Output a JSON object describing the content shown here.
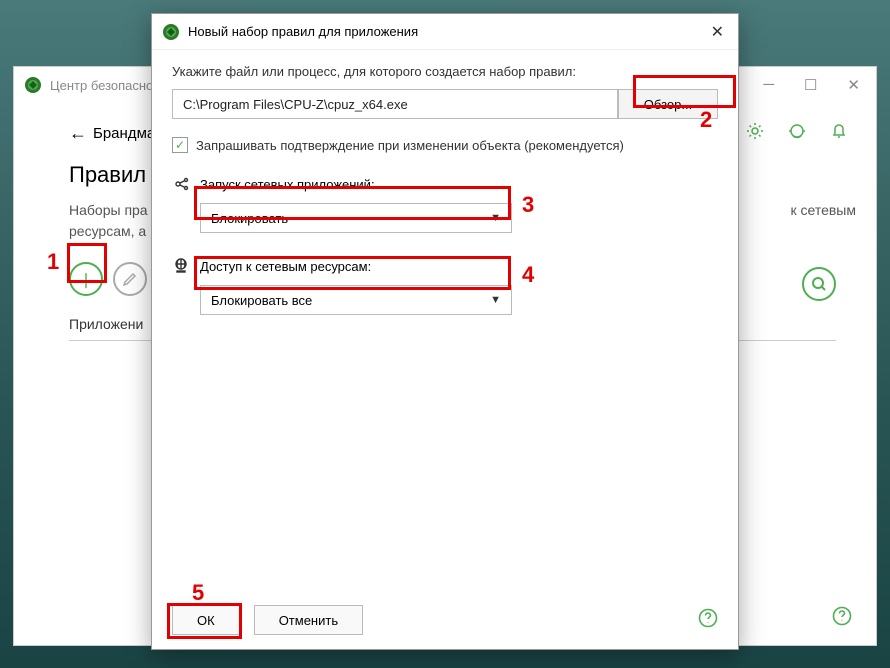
{
  "bg": {
    "title": "Центр безопасност",
    "breadcrumb": "Брандмау",
    "heading": "Правил",
    "description1": "Наборы пра",
    "description2": "ресурсам, а",
    "tab": "Приложени",
    "network_text": "к сетевым"
  },
  "fg": {
    "title": "Новый набор правил для приложения",
    "label": "Укажите файл или процесс, для которого создается набор правил:",
    "path": "C:\\Program Files\\CPU-Z\\cpuz_x64.exe",
    "browse": "Обзор...",
    "checkbox_label": "Запрашивать подтверждение при изменении объекта (рекомендуется)",
    "launch_label": "Запуск сетевых приложений:",
    "launch_value": "Блокировать",
    "access_label": "Доступ к сетевым ресурсам:",
    "access_value": "Блокировать все",
    "ok": "ОК",
    "cancel": "Отменить"
  },
  "annotations": {
    "n1": "1",
    "n2": "2",
    "n3": "3",
    "n4": "4",
    "n5": "5"
  }
}
